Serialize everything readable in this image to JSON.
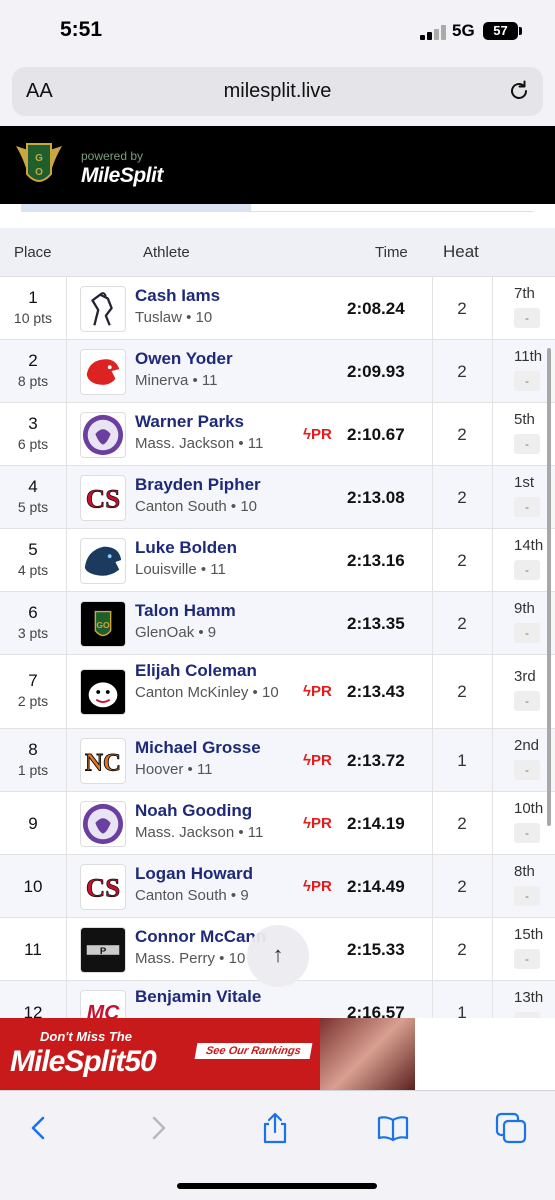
{
  "status_bar": {
    "time": "5:51",
    "network": "5G",
    "battery": "57"
  },
  "browser": {
    "aa_label": "AA",
    "url": "milesplit.live"
  },
  "site": {
    "powered_by": "powered by",
    "brand": "MileSplit"
  },
  "table": {
    "headers": {
      "place": "Place",
      "athlete": "Athlete",
      "time": "Time",
      "heat": "Heat"
    },
    "rows": [
      {
        "place": "1",
        "pts": "10 pts",
        "name": "Cash Iams",
        "school": "Tuslaw • 10",
        "pr": "",
        "time": "2:08.24",
        "heat": "2",
        "heat_place": "7th",
        "heat_box": "-"
      },
      {
        "place": "2",
        "pts": "8 pts",
        "name": "Owen Yoder",
        "school": "Minerva • 11",
        "pr": "",
        "time": "2:09.93",
        "heat": "2",
        "heat_place": "11th",
        "heat_box": "-"
      },
      {
        "place": "3",
        "pts": "6 pts",
        "name": "Warner Parks",
        "school": "Mass. Jackson • 11",
        "pr": "PR",
        "time": "2:10.67",
        "heat": "2",
        "heat_place": "5th",
        "heat_box": "-"
      },
      {
        "place": "4",
        "pts": "5 pts",
        "name": "Brayden Pipher",
        "school": "Canton South • 10",
        "pr": "",
        "time": "2:13.08",
        "heat": "2",
        "heat_place": "1st",
        "heat_box": "-"
      },
      {
        "place": "5",
        "pts": "4 pts",
        "name": "Luke Bolden",
        "school": "Louisville • 11",
        "pr": "",
        "time": "2:13.16",
        "heat": "2",
        "heat_place": "14th",
        "heat_box": "-"
      },
      {
        "place": "6",
        "pts": "3 pts",
        "name": "Talon Hamm",
        "school": "GlenOak • 9",
        "pr": "",
        "time": "2:13.35",
        "heat": "2",
        "heat_place": "9th",
        "heat_box": "-"
      },
      {
        "place": "7",
        "pts": "2 pts",
        "name": "Elijah Coleman",
        "school": "Canton McKinley • 10",
        "pr": "PR",
        "time": "2:13.43",
        "heat": "2",
        "heat_place": "3rd",
        "heat_box": "-"
      },
      {
        "place": "8",
        "pts": "1 pts",
        "name": "Michael Grosse",
        "school": "Hoover • 11",
        "pr": "PR",
        "time": "2:13.72",
        "heat": "1",
        "heat_place": "2nd",
        "heat_box": "-"
      },
      {
        "place": "9",
        "pts": "",
        "name": "Noah Gooding",
        "school": "Mass. Jackson • 11",
        "pr": "PR",
        "time": "2:14.19",
        "heat": "2",
        "heat_place": "10th",
        "heat_box": "-"
      },
      {
        "place": "10",
        "pts": "",
        "name": "Logan Howard",
        "school": "Canton South • 9",
        "pr": "PR",
        "time": "2:14.49",
        "heat": "2",
        "heat_place": "8th",
        "heat_box": "-"
      },
      {
        "place": "11",
        "pts": "",
        "name": "Connor McCann",
        "school": "Mass. Perry • 10",
        "pr": "",
        "time": "2:15.33",
        "heat": "2",
        "heat_place": "15th",
        "heat_box": "-"
      },
      {
        "place": "12",
        "pts": "",
        "name": "Benjamin Vitale",
        "school": "",
        "pr": "",
        "time": "2:16.57",
        "heat": "1",
        "heat_place": "13th",
        "heat_box": "-"
      }
    ]
  },
  "scroll_top_icon": "arrow-up-icon",
  "ad": {
    "dont_miss": "Don't Miss The",
    "brand": "MileSplit50",
    "button": "See Our Rankings"
  },
  "colors": {
    "name_blue": "#1e2a78",
    "pr_red": "#e41b1b",
    "header_black": "#000000",
    "ios_blue": "#1a73e8"
  }
}
